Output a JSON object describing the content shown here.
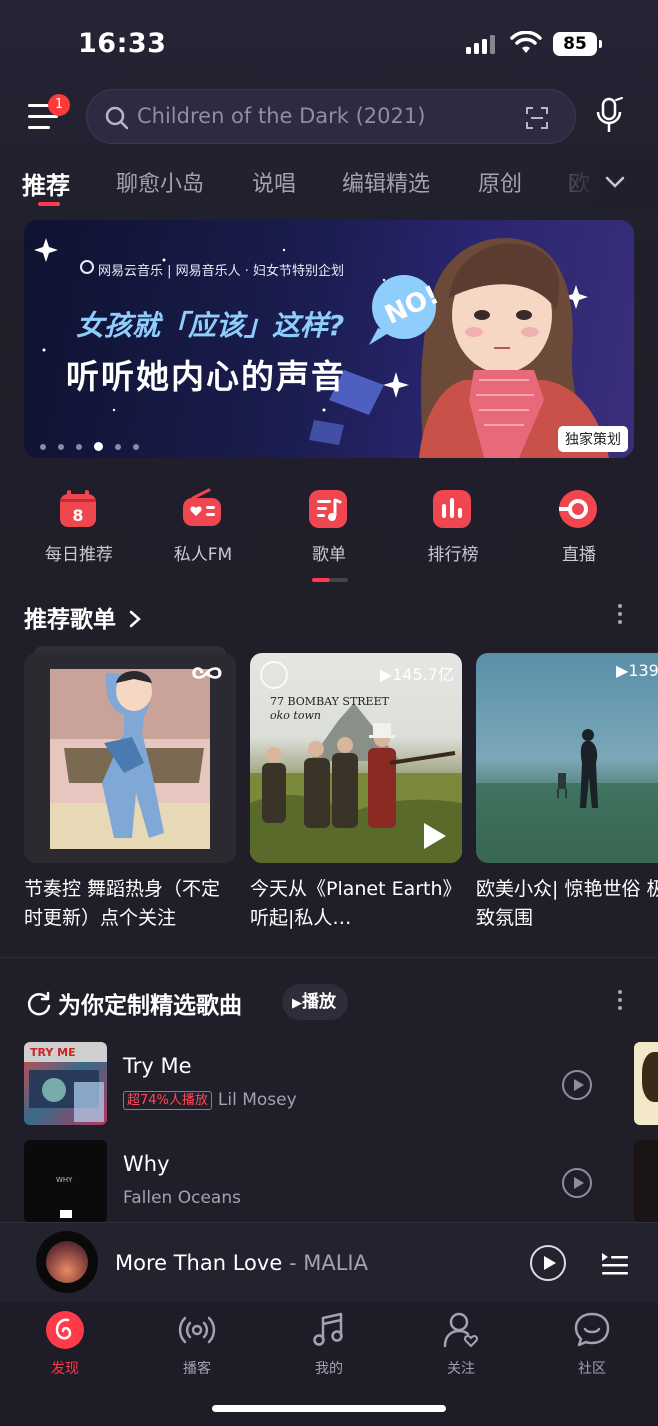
{
  "status_bar": {
    "time": "16:33",
    "battery": "85"
  },
  "header": {
    "menu_badge": "1",
    "search_placeholder": "Children of the Dark (2021)"
  },
  "tabs": [
    {
      "label": "推荐",
      "active": true
    },
    {
      "label": "聊愈小岛"
    },
    {
      "label": "说唱"
    },
    {
      "label": "编辑精选"
    },
    {
      "label": "原创"
    },
    {
      "label": "欧"
    }
  ],
  "banner": {
    "brand_line": "网易云音乐 | 网易音乐人 · 妇女节特别企划",
    "line1": "女孩就「应该」这样?",
    "line2": "听听她内心的声音",
    "badge": "NO!",
    "tag": "独家策划",
    "page_count": 6,
    "current_page": 4
  },
  "quick_entries": [
    {
      "label": "每日推荐",
      "icon": "calendar-icon",
      "day": "8"
    },
    {
      "label": "私人FM",
      "icon": "radio-icon"
    },
    {
      "label": "歌单",
      "icon": "playlist-icon"
    },
    {
      "label": "排行榜",
      "icon": "chart-icon"
    },
    {
      "label": "直播",
      "icon": "live-icon"
    }
  ],
  "recommended_playlists": {
    "title": "推荐歌单",
    "items": [
      {
        "title": "节奏控 舞蹈热身（不定时更新）点个关注",
        "play_count": ""
      },
      {
        "title": "今天从《Planet Earth》听起|私人…",
        "play_count": "145.7亿",
        "cover_text_1": "77 BOMBAY STREET",
        "cover_text_2": "oko town"
      },
      {
        "title": "欧美小众| 惊艳世俗 极致氛围",
        "play_count": "139"
      }
    ]
  },
  "custom_songs": {
    "title": "为你定制精选歌曲",
    "play_label": "播放",
    "songs": [
      {
        "title": "Try Me",
        "tag": "超74%人播放",
        "artist": "Lil Mosey",
        "art_text": "TRY ME"
      },
      {
        "title": "Why",
        "tag": "",
        "artist": "Fallen Oceans",
        "art_text": "WHY"
      }
    ]
  },
  "mini_player": {
    "title": "More Than Love",
    "separator": " - ",
    "artist": "MALIA"
  },
  "bottom_nav": [
    {
      "label": "发现",
      "icon": "discover-icon",
      "active": true
    },
    {
      "label": "播客",
      "icon": "podcast-icon"
    },
    {
      "label": "我的",
      "icon": "music-note-icon"
    },
    {
      "label": "关注",
      "icon": "follow-icon"
    },
    {
      "label": "社区",
      "icon": "community-icon"
    }
  ],
  "colors": {
    "accent": "#ff3a4a",
    "background": "#1f1e29",
    "banner_blue": "#8ecdfc"
  }
}
